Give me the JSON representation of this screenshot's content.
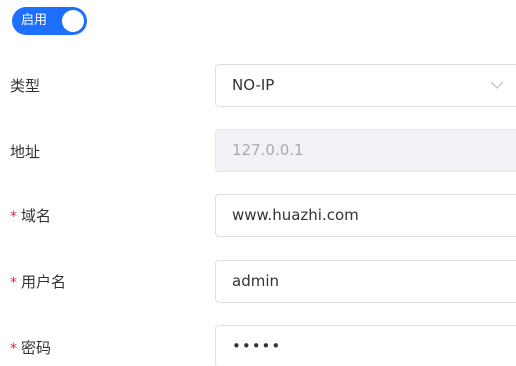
{
  "toggle": {
    "label": "启用",
    "checked": true,
    "color": "#1e6fff"
  },
  "form": {
    "type": {
      "label": "类型",
      "value": "NO-IP",
      "required": false
    },
    "address": {
      "label": "地址",
      "value": "127.0.0.1",
      "required": false,
      "disabled": true
    },
    "domain": {
      "label": "域名",
      "value": "www.huazhi.com",
      "required": true
    },
    "username": {
      "label": "用户名",
      "value": "admin",
      "required": true
    },
    "password": {
      "label": "密码",
      "value": "•••••",
      "required": true
    }
  },
  "required_mark": "*",
  "icons": {
    "select_arrow": "chevron-down-icon"
  }
}
